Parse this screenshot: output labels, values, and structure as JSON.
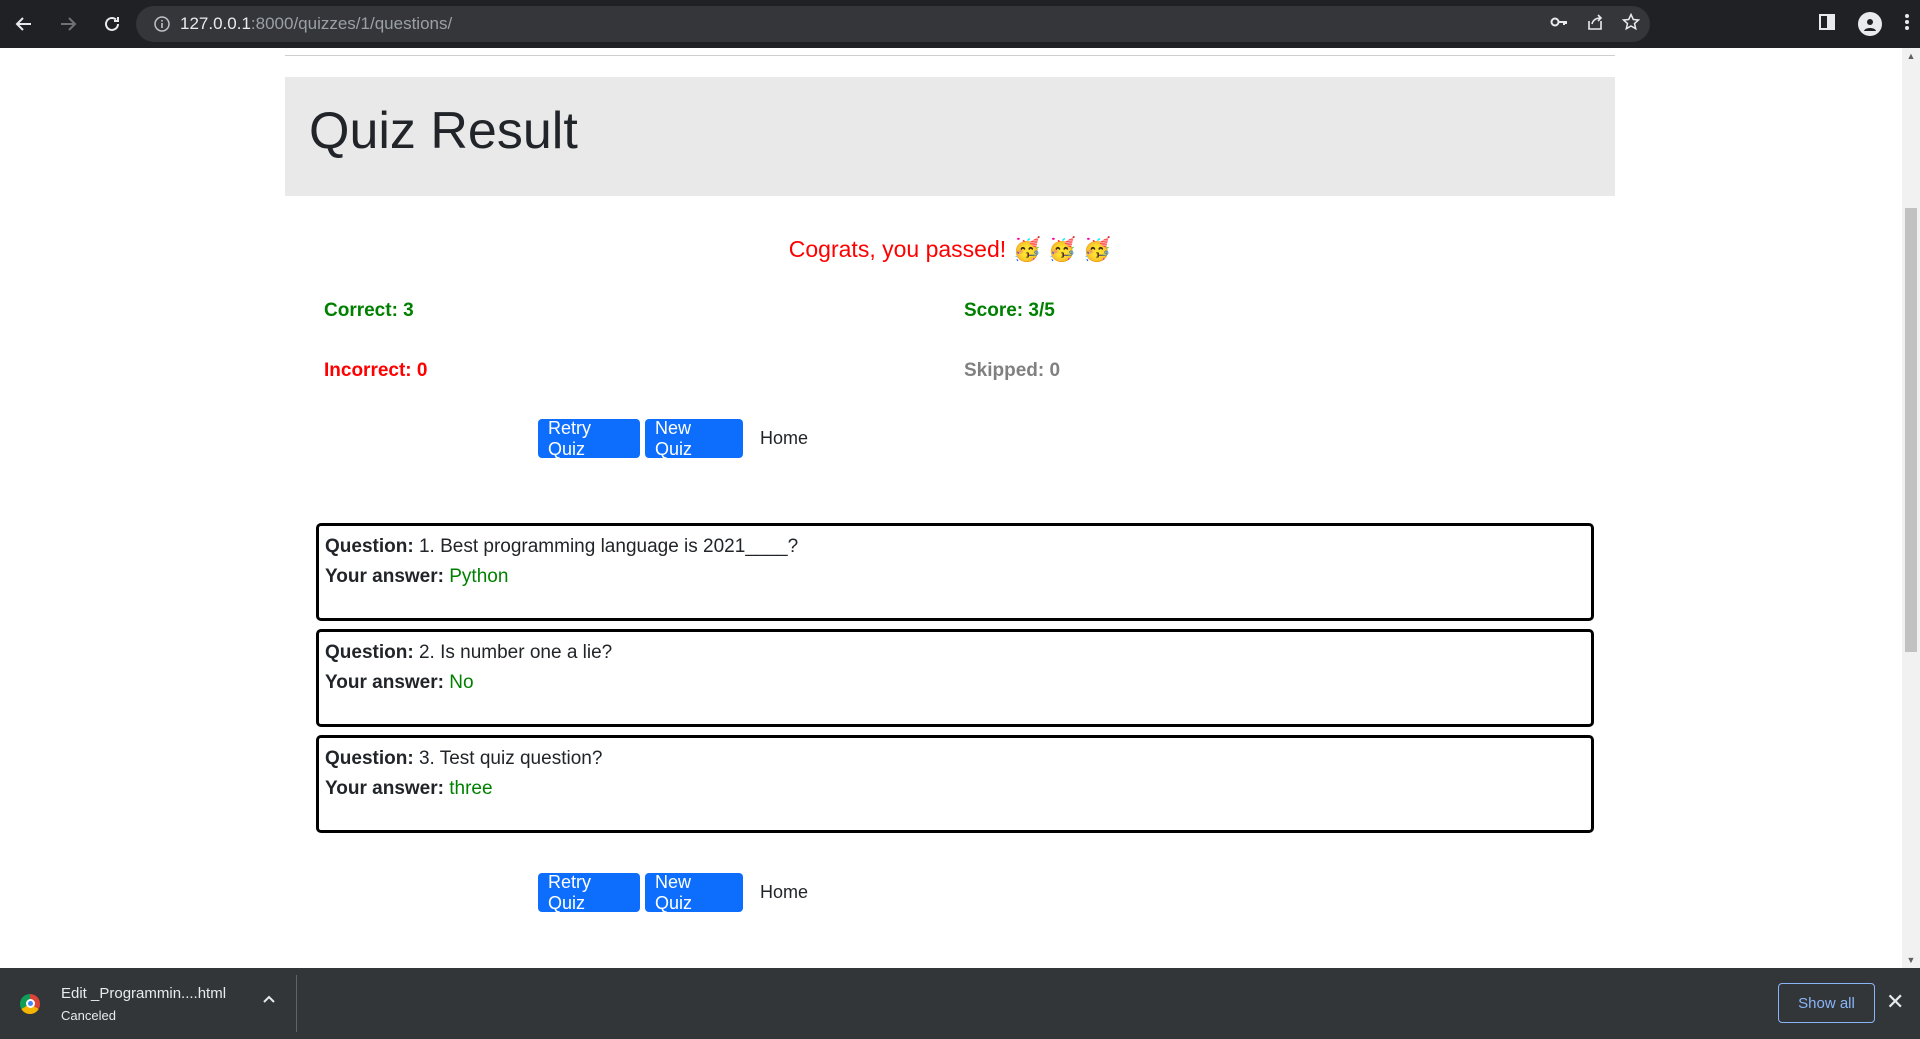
{
  "browser": {
    "url_host": "127.0.0.1",
    "url_rest": ":8000/quizzes/1/questions/"
  },
  "page": {
    "title": "Quiz Result",
    "message": "Cograts, you passed! 🥳 🥳 🥳",
    "correct": "Correct: 3",
    "score": "Score: 3/5",
    "incorrect": "Incorrect: 0",
    "skipped": "Skipped: 0",
    "buttons": {
      "retry": "Retry Quiz",
      "new": "New Quiz",
      "home": "Home"
    },
    "question_label": "Question:",
    "answer_label": "Your answer:",
    "questions": [
      {
        "text": "1. Best programming language is 2021____?",
        "answer": "Python"
      },
      {
        "text": "2. Is number one a lie?",
        "answer": "No"
      },
      {
        "text": "3. Test quiz question?",
        "answer": "three"
      }
    ]
  },
  "download_bar": {
    "file_name": "Edit _Programmin....html",
    "status": "Canceled",
    "show_all": "Show all"
  },
  "colors": {
    "pass": "#ff0000",
    "correct": "#008000",
    "incorrect": "#ff0000",
    "skipped": "#808080",
    "button": "#0d6efd"
  }
}
